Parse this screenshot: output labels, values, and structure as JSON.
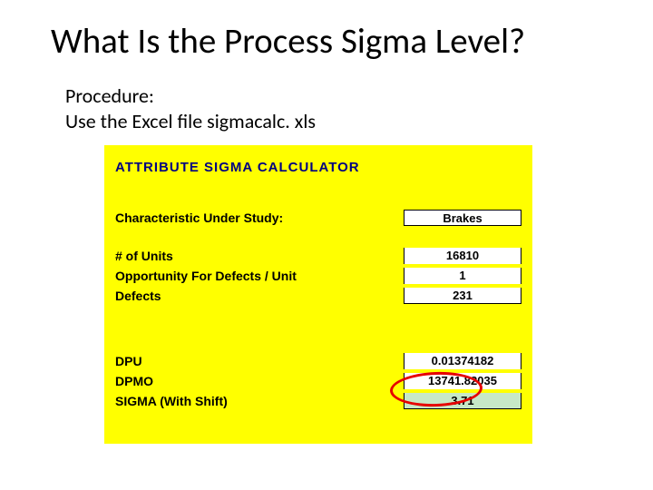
{
  "title": "What Is the Process Sigma Level?",
  "body": {
    "line1": "Procedure:",
    "line2": "Use the Excel file sigmacalc. xls"
  },
  "calc": {
    "heading": "ATTRIBUTE  SIGMA  CALCULATOR",
    "char_label": "Characteristic Under Study:",
    "char_value": "Brakes",
    "units_label": "# of Units",
    "units_value": "16810",
    "opp_label": "Opportunity For Defects / Unit",
    "opp_value": "1",
    "defects_label": "Defects",
    "defects_value": "231",
    "dpu_label": "DPU",
    "dpu_value": "0.01374182",
    "dpmo_label": "DPMO",
    "dpmo_value": "13741.82035",
    "sigma_label": "SIGMA (With Shift)",
    "sigma_value": "3.71"
  }
}
